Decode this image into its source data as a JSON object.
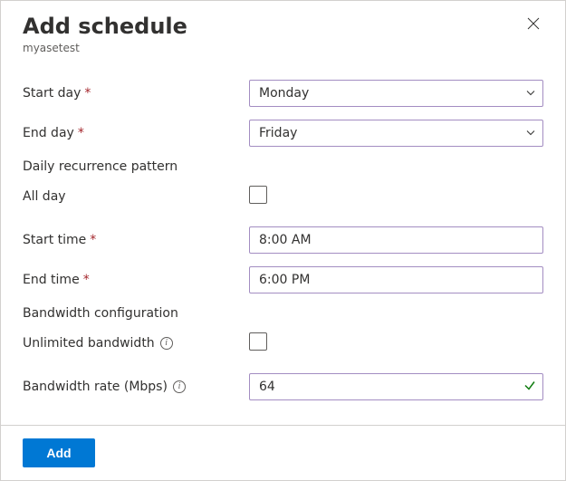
{
  "header": {
    "title": "Add schedule",
    "subtitle": "myasetest"
  },
  "fields": {
    "start_day": {
      "label": "Start day",
      "value": "Monday"
    },
    "end_day": {
      "label": "End day",
      "value": "Friday"
    },
    "recurrence_section": "Daily recurrence pattern",
    "all_day": {
      "label": "All day"
    },
    "start_time": {
      "label": "Start time",
      "value": "8:00 AM"
    },
    "end_time": {
      "label": "End time",
      "value": "6:00 PM"
    },
    "bandwidth_section": "Bandwidth configuration",
    "unlimited": {
      "label": "Unlimited bandwidth"
    },
    "rate": {
      "label": "Bandwidth rate (Mbps)",
      "value": "64"
    }
  },
  "footer": {
    "add_label": "Add"
  }
}
